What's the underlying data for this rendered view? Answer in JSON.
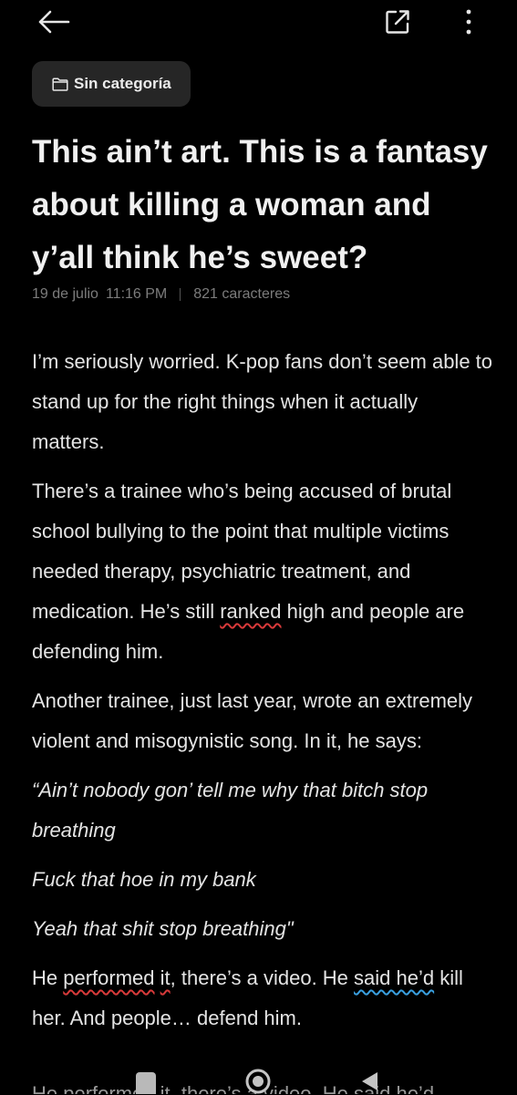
{
  "toolbar": {
    "back_icon": "arrow-left-icon",
    "share_icon": "open-external-icon",
    "more_icon": "vertical-dots-icon"
  },
  "category": {
    "icon": "folder-icon",
    "label": "Sin categoría"
  },
  "note": {
    "title": "This ain’t art. This is a fantasy about killing a woman and y’all think he’s sweet?",
    "date": "19 de julio",
    "time": "11:16 PM",
    "char_count": "821 caracteres"
  },
  "body": {
    "p1": "I’m seriously worried. K-pop fans don’t seem able to stand up for the right things when it actually matters.",
    "p2_before": "There’s a trainee who’s being accused of brutal school bullying  to the point that multiple victims needed therapy, psychiatric treatment, and medication. He’s still ",
    "p2_flagged": "ranked",
    "p2_after": " high and people are defending him.",
    "p3": "Another trainee, just last year, wrote an extremely violent and misogynistic song. In it, he says:",
    "lyric1": "“Ain’t nobody gon’ tell me why that bitch stop breathing",
    "lyric2": "Fuck that hoe in my bank",
    "lyric3": "Yeah that shit stop breathing\"",
    "p4_a": "He ",
    "p4_flag1": "performed",
    "p4_b": " ",
    "p4_flag2": "it",
    "p4_c": ", there’s a video. He ",
    "p4_flag3": "said he’d",
    "p4_d": " kill her. And people… defend him.",
    "ghost_line": "He performed it, there’s a video. He said he’d"
  },
  "colors": {
    "background": "#000000",
    "chip": "#262626",
    "spell_error": "#d83a3a",
    "grammar_hint": "#3aa0e0"
  },
  "navbar": {
    "home_icon": "recent-apps-icon",
    "center_icon": "home-circle-icon",
    "back_icon": "triangle-back-icon"
  }
}
